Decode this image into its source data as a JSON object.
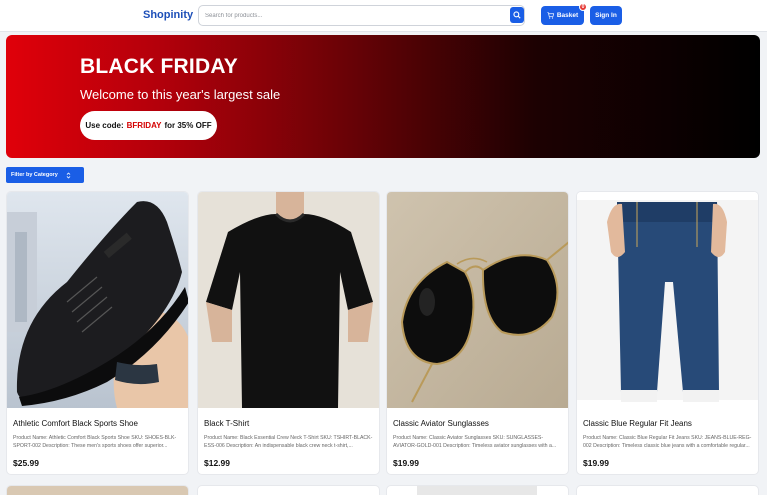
{
  "header": {
    "brand": "Shopinity",
    "search_placeholder": "Search for products...",
    "basket_label": "Basket",
    "basket_count": "0",
    "signin_label": "Sign In"
  },
  "hero": {
    "title": "BLACK FRIDAY",
    "subtitle": "Welcome to this year's largest sale",
    "code_prefix": "Use code:",
    "code": "BFRIDAY",
    "code_suffix": "for 35% OFF"
  },
  "filter": {
    "label": "Filter by Category"
  },
  "products": [
    {
      "title": "Athletic Comfort Black Sports Shoe",
      "description": "Product Name: Athletic Comfort Black Sports Shoe SKU: SHOES-BLK-SPORT-002 Description: These men's sports shoes offer superior...",
      "price": "$25.99"
    },
    {
      "title": "Black T-Shirt",
      "description": "Product Name: Black Essential Crew Neck T-Shirt SKU: TSHIRT-BLACK-ESS-006 Description: An indispensable black crew neck t-shirt,...",
      "price": "$12.99"
    },
    {
      "title": "Classic Aviator Sunglasses",
      "description": "Product Name: Classic Aviator Sunglasses SKU: SUNGLASSES-AVIATOR-GOLD-001 Description: Timeless aviator sunglasses with a...",
      "price": "$19.99"
    },
    {
      "title": "Classic Blue Regular Fit Jeans",
      "description": "Product Name: Classic Blue Regular Fit Jeans SKU: JEANS-BLUE-REG-002 Description: Timeless classic blue jeans with a comfortable regular...",
      "price": "$19.99"
    }
  ]
}
